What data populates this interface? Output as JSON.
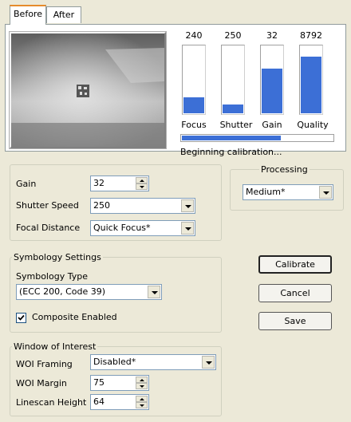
{
  "tabs": [
    {
      "label": "Before",
      "active": true
    },
    {
      "label": "After",
      "active": false
    }
  ],
  "metrics": [
    {
      "label": "Focus",
      "value": "240",
      "level": 0.23
    },
    {
      "label": "Shutter",
      "value": "250",
      "level": 0.13
    },
    {
      "label": "Gain",
      "value": "32",
      "level": 0.65
    },
    {
      "label": "Quality",
      "value": "8792",
      "level": 0.82
    }
  ],
  "progress": {
    "level": 0.65,
    "status_text": "Beginning calibration..."
  },
  "camera_settings": {
    "gain_label": "Gain",
    "gain_value": "32",
    "shutter_label": "Shutter Speed",
    "shutter_value": "250",
    "focal_label": "Focal Distance",
    "focal_value": "Quick Focus*"
  },
  "processing": {
    "title": "Processing",
    "value": "Medium*"
  },
  "symbology": {
    "title": "Symbology Settings",
    "type_label": "Symbology Type",
    "type_value": "(ECC 200, Code 39)",
    "composite_label": "Composite Enabled",
    "composite_checked": true
  },
  "woi": {
    "title": "Window of Interest",
    "framing_label": "WOI Framing",
    "framing_value": "Disabled*",
    "margin_label": "WOI Margin",
    "margin_value": "75",
    "linescan_label": "Linescan Height",
    "linescan_value": "64"
  },
  "buttons": {
    "calibrate": "Calibrate",
    "cancel": "Cancel",
    "save": "Save"
  },
  "colors": {
    "meter_fill": "#3c6fd6",
    "tab_highlight": "#e68b2c"
  }
}
